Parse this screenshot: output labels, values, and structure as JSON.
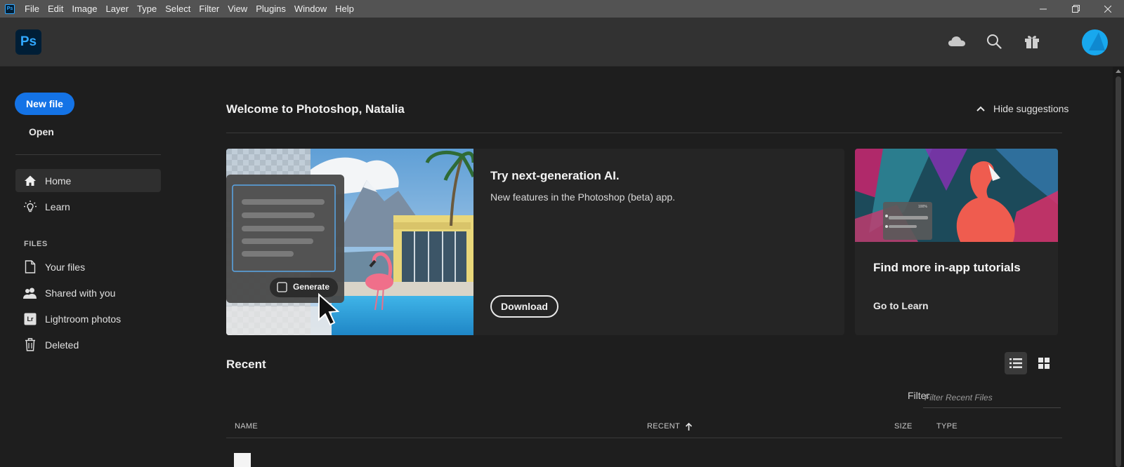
{
  "menubar": {
    "app_icon_text": "Ps",
    "items": [
      "File",
      "Edit",
      "Image",
      "Layer",
      "Type",
      "Select",
      "Filter",
      "View",
      "Plugins",
      "Window",
      "Help"
    ],
    "window_controls": [
      "minimize-icon",
      "restore-icon",
      "close-icon"
    ]
  },
  "header": {
    "logo": "Ps",
    "icons": [
      "cloud-icon",
      "search-icon",
      "gift-icon"
    ],
    "avatar": "avatar"
  },
  "sidebar": {
    "new_file": "New file",
    "open": "Open",
    "nav": [
      {
        "label": "Home",
        "icon": "home-icon",
        "active": true
      },
      {
        "label": "Learn",
        "icon": "lightbulb-icon",
        "active": false
      }
    ],
    "files_section": "FILES",
    "files": [
      {
        "label": "Your files",
        "icon": "file-icon"
      },
      {
        "label": "Shared with you",
        "icon": "shared-users-icon"
      },
      {
        "label": "Lightroom photos",
        "icon": "lightroom-icon"
      },
      {
        "label": "Deleted",
        "icon": "trash-icon"
      }
    ],
    "lightroom_badge": "Lr"
  },
  "main": {
    "welcome": "Welcome to Photoshop, Natalia",
    "hide_suggestions": "Hide suggestions",
    "ai_card": {
      "title": "Try next-generation AI.",
      "description": "New features in the Photoshop (beta) app.",
      "button": "Download",
      "image_generate_label": "Generate"
    },
    "learn_card": {
      "title": "Find more in-app tutorials",
      "link": "Go to Learn",
      "image_percent": "100%"
    },
    "recent": {
      "title": "Recent",
      "filter_label": "Filter",
      "filter_placeholder": "Filter Recent Files",
      "view_modes": [
        "list-view-icon",
        "grid-view-icon"
      ],
      "columns": {
        "name": "NAME",
        "recent": "RECENT",
        "size": "SIZE",
        "type": "TYPE"
      }
    }
  },
  "colors": {
    "accent": "#1473e6",
    "ps_blue": "#31a8ff",
    "background": "#1e1e1e",
    "header": "#323232",
    "menubar": "#535353"
  }
}
